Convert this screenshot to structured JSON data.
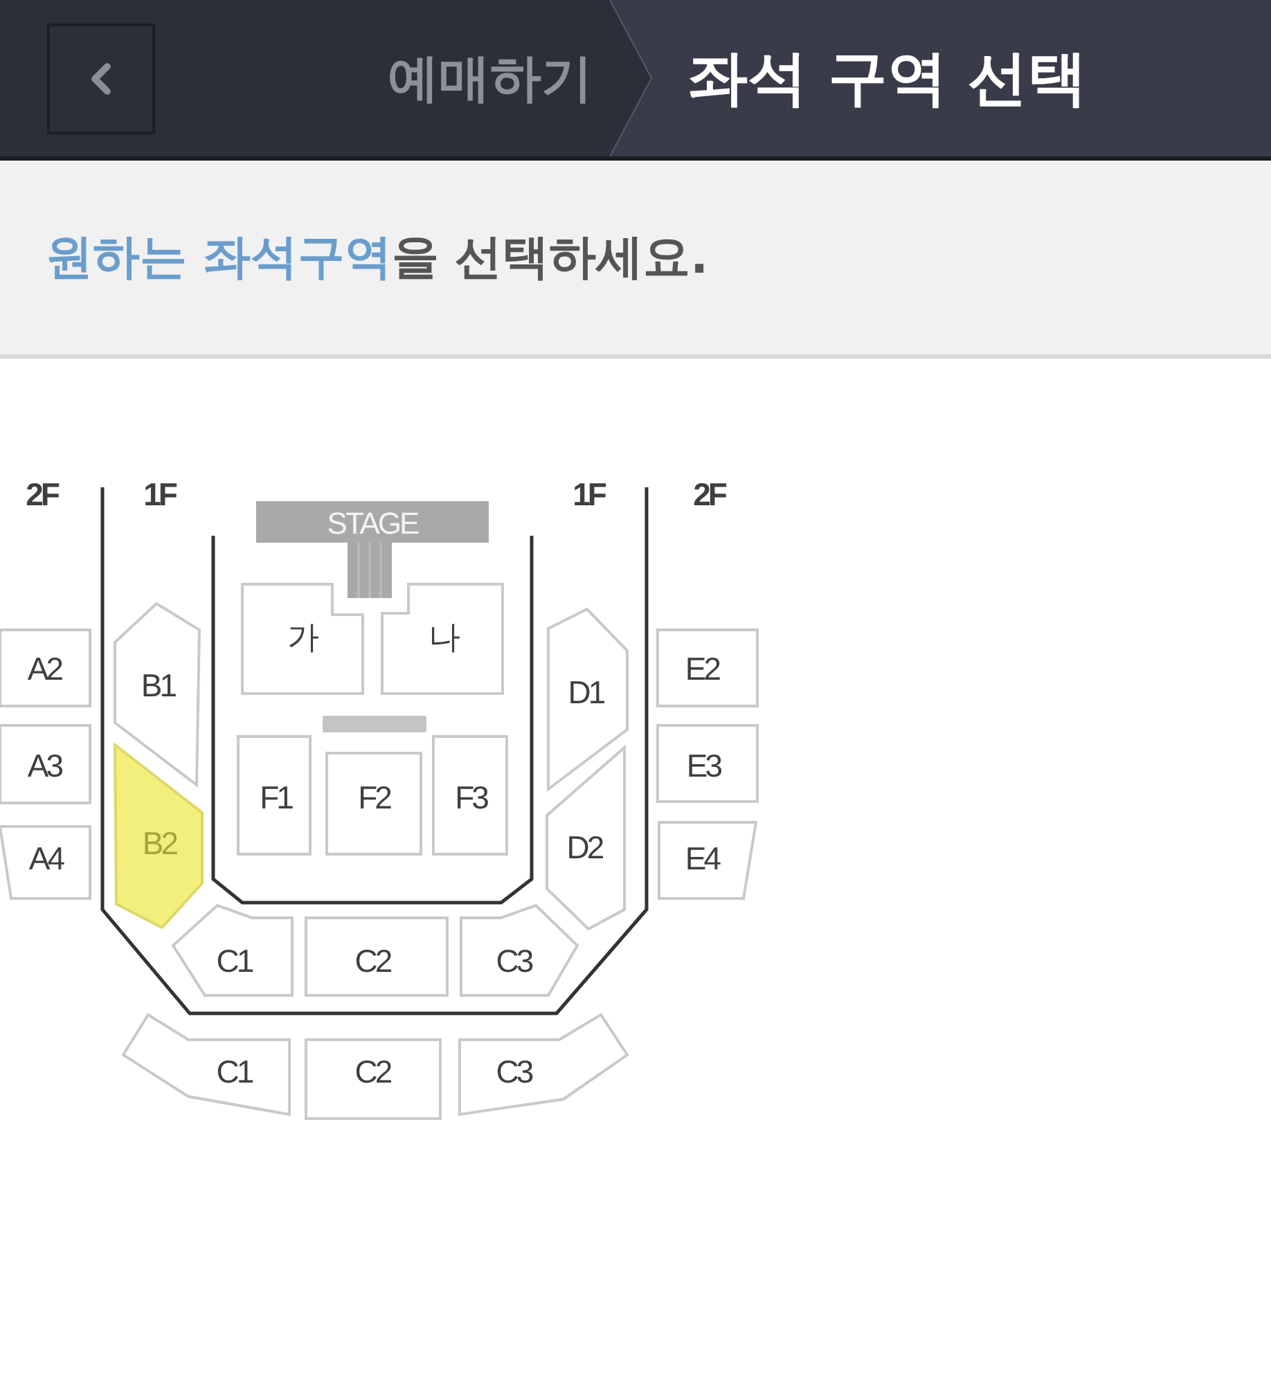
{
  "header": {
    "breadcrumb": {
      "previous": "예매하기",
      "current": "좌석 구역 선택"
    }
  },
  "instruction": {
    "highlight": "원하는 좌석구역",
    "rest": "을 선택하세요."
  },
  "seat_map": {
    "floor_labels": [
      "2F",
      "1F",
      "1F",
      "2F"
    ],
    "stage": {
      "label": "STAGE"
    },
    "sections": [
      {
        "label": "A2",
        "selected": false
      },
      {
        "label": "A3",
        "selected": false
      },
      {
        "label": "A4",
        "selected": false
      },
      {
        "label": "B1",
        "selected": false
      },
      {
        "label": "B2",
        "selected": true
      },
      {
        "label": "가",
        "selected": false
      },
      {
        "label": "나",
        "selected": false
      },
      {
        "label": "F1",
        "selected": false
      },
      {
        "label": "F2",
        "selected": false
      },
      {
        "label": "F3",
        "selected": false
      },
      {
        "label": "D1",
        "selected": false
      },
      {
        "label": "D2",
        "selected": false
      },
      {
        "label": "E2",
        "selected": false
      },
      {
        "label": "E3",
        "selected": false
      },
      {
        "label": "E4",
        "selected": false
      },
      {
        "label": "C1",
        "selected": false
      },
      {
        "label": "C2",
        "selected": false
      },
      {
        "label": "C3",
        "selected": false
      },
      {
        "label": "C1",
        "selected": false
      },
      {
        "label": "C2",
        "selected": false
      },
      {
        "label": "C3",
        "selected": false
      }
    ]
  }
}
